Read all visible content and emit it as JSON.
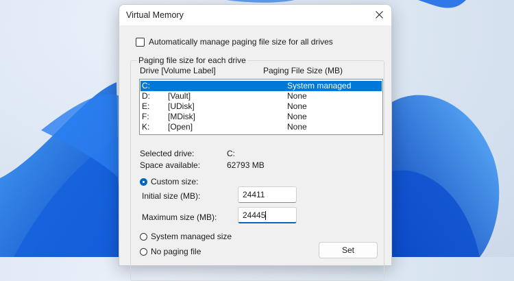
{
  "window": {
    "title": "Virtual Memory"
  },
  "auto_manage": {
    "label": "Automatically manage paging file size for all drives",
    "checked": false
  },
  "group": {
    "legend": "Paging file size for each drive",
    "headers": {
      "drive": "Drive  [Volume Label]",
      "size": "Paging File Size (MB)"
    },
    "drives": [
      {
        "drive": "C:",
        "label": "",
        "size": "System managed",
        "selected": true
      },
      {
        "drive": "D:",
        "label": "[Vault]",
        "size": "None",
        "selected": false
      },
      {
        "drive": "E:",
        "label": "[UDisk]",
        "size": "None",
        "selected": false
      },
      {
        "drive": "F:",
        "label": "[MDisk]",
        "size": "None",
        "selected": false
      },
      {
        "drive": "K:",
        "label": "[Open]",
        "size": "None",
        "selected": false
      }
    ]
  },
  "info": {
    "selected_drive_label": "Selected drive:",
    "selected_drive_value": "C:",
    "space_label": "Space available:",
    "space_value": "62793 MB"
  },
  "options": {
    "custom_size_label": "Custom size:",
    "initial_label": "Initial size (MB):",
    "initial_value": "24411",
    "maximum_label": "Maximum size (MB):",
    "maximum_value": "24445",
    "system_managed_label": "System managed size",
    "no_paging_label": "No paging file",
    "selected": "custom"
  },
  "buttons": {
    "set_label": "Set"
  },
  "colors": {
    "selection": "#0078d7",
    "accent": "#0067c0"
  }
}
